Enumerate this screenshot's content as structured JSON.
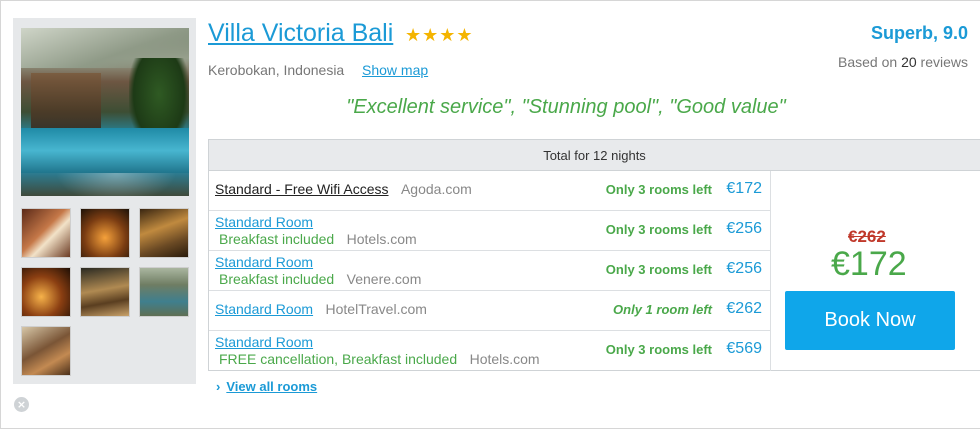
{
  "hotel": {
    "name": "Villa Victoria Bali",
    "stars": "★★★★",
    "location": "Kerobokan, Indonesia",
    "show_map": "Show map"
  },
  "rating": {
    "label": "Superb, 9.0",
    "reviews_prefix": "Based on",
    "reviews_count": "20",
    "reviews_suffix": "reviews"
  },
  "quotes": "\"Excellent service\",   \"Stunning pool\",   \"Good value\"",
  "rates": {
    "header": "Total for 12 nights",
    "rows": [
      {
        "room": "Standard - Free Wifi Access",
        "extra": "",
        "provider": "Agoda.com",
        "availability": "Only 3 rooms left",
        "price": "€172"
      },
      {
        "room": "Standard Room",
        "extra": "Breakfast included",
        "provider": "Hotels.com",
        "availability": "Only 3 rooms left",
        "price": "€256"
      },
      {
        "room": "Standard Room",
        "extra": "Breakfast included",
        "provider": "Venere.com",
        "availability": "Only 3 rooms left",
        "price": "€256"
      },
      {
        "room": "Standard Room",
        "extra": "",
        "provider": "HotelTravel.com",
        "availability": "Only 1 room left",
        "price": "€262"
      },
      {
        "room": "Standard Room",
        "extra": "FREE cancellation, Breakfast included",
        "provider": "Hotels.com",
        "availability": "Only 3 rooms left",
        "price": "€569"
      }
    ]
  },
  "deal": {
    "old_price": "€262",
    "new_price": "€172",
    "book_label": "Book Now"
  },
  "view_all": {
    "chevron": "›",
    "label": "View all rooms"
  },
  "close_icon": "×",
  "colors": {
    "accent": "#1b9ad6",
    "green": "#4aa84a",
    "button": "#0fa6ea",
    "strike": "#c0392b",
    "star": "#f4b400"
  }
}
